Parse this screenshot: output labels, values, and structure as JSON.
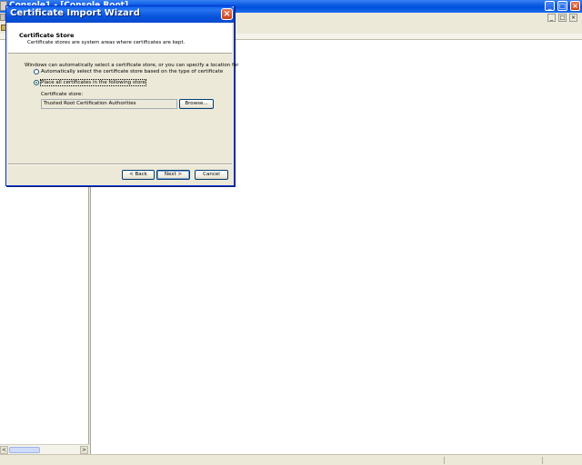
{
  "background_window": {
    "title": "Console1 - [Console Root]",
    "caption_buttons": [
      "_",
      "□",
      "×"
    ],
    "inner_caption_buttons": [
      "_",
      "□",
      "×"
    ]
  },
  "dialog": {
    "title": "Certificate Import Wizard",
    "close_glyph": "×",
    "header": {
      "title": "Certificate Store",
      "subtitle": "Certificate stores are system areas where certificates are kept."
    },
    "intro": "Windows can automatically select a certificate store, or you can specify a location for",
    "options": [
      {
        "label": "Automatically select the certificate store based on the type of certificate",
        "checked": false
      },
      {
        "label": "Place all certificates in the following store",
        "checked": true
      }
    ],
    "store_label": "Certificate store:",
    "store_value": "Trusted Root Certification Authorities",
    "browse_label": "Browse...",
    "back_label": "< Back",
    "next_label": "Next >",
    "cancel_label": "Cancel"
  },
  "scroll_glyphs": {
    "left": "<",
    "right": ">"
  },
  "colors": {
    "title_blue": "#0a55de",
    "close_red": "#c8421a",
    "radio_dot": "#21a121"
  }
}
